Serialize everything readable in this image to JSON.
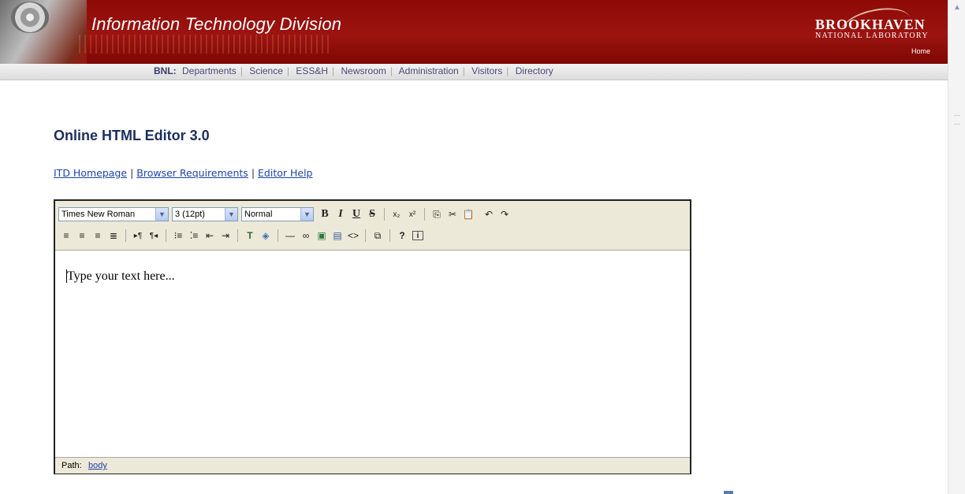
{
  "banner": {
    "title": "Information Technology Division",
    "logo_name": "BROOKHAVEN",
    "logo_sub": "NATIONAL LABORATORY",
    "home": "Home"
  },
  "nav": {
    "prefix": "BNL:",
    "items": [
      "Departments",
      "Science",
      "ESS&H",
      "Newsroom",
      "Administration",
      "Visitors",
      "Directory"
    ]
  },
  "page": {
    "title": "Online HTML Editor 3.0",
    "links": [
      "ITD Homepage",
      "Browser Requirements",
      "Editor Help"
    ]
  },
  "toolbar": {
    "font": "Times New Roman",
    "size": "3 (12pt)",
    "format": "Normal",
    "bold": "B",
    "italic": "I",
    "underline": "U",
    "strike": "S",
    "help": "?",
    "info": "i"
  },
  "editor": {
    "content": "Type your text here...",
    "path_label": "Path:",
    "path_value": "body"
  },
  "colors": {
    "banner": "#9c1410",
    "title": "#1b2f5e",
    "link": "#1e44a8",
    "toolbar_bg": "#ede9d8"
  }
}
